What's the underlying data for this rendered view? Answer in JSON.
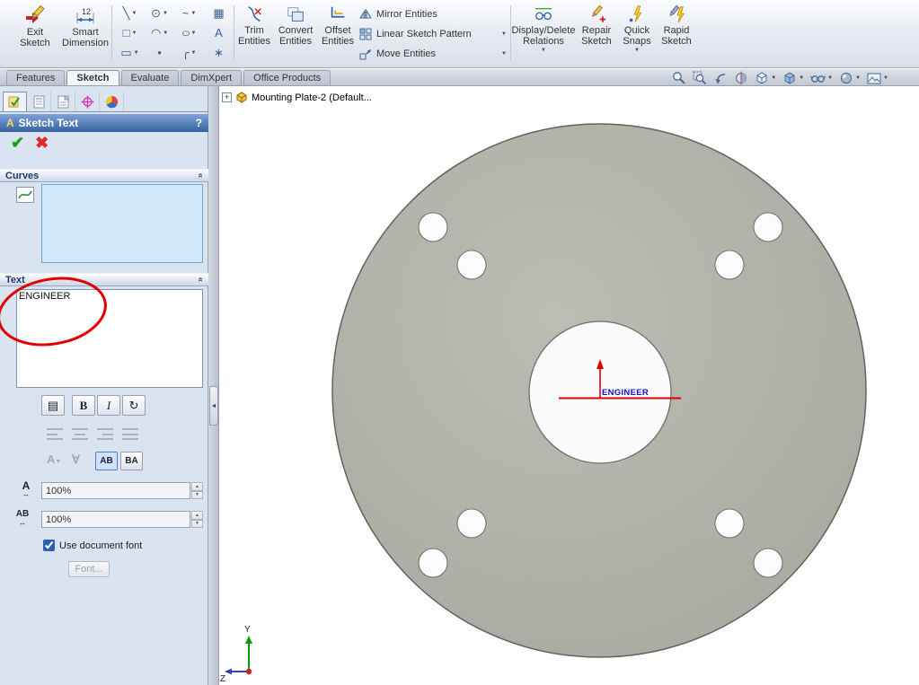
{
  "icons": {
    "dropdown": "▼",
    "collapse_chevron": "»",
    "ok": "✔",
    "cancel": "✖",
    "line": "╲",
    "circle": "⊙",
    "spline": "~",
    "grid": "▦",
    "rectangle": "□",
    "arc": "◠",
    "ellipse": "○",
    "text_tool": "A",
    "slot": "▭",
    "point": "•",
    "fillet": "╭",
    "pattern": "∗",
    "style": "▤",
    "bold": "B",
    "italic": "I",
    "rotate": "↻",
    "flip_vertical": "A",
    "flip_horizontal": "∀",
    "h_arrow": "↔",
    "expand_plus": "+",
    "splitter_arrow": "◄",
    "width_factor_glyph": "A",
    "spacing_glyph": "AB"
  },
  "ribbon": {
    "exit_sketch": "Exit\nSketch",
    "smart_dimension": "Smart\nDimension",
    "trim_entities": "Trim\nEntities",
    "convert_entities": "Convert\nEntities",
    "offset_entities": "Offset\nEntities",
    "mirror_entities": "Mirror Entities",
    "linear_sketch_pattern": "Linear Sketch Pattern",
    "move_entities": "Move Entities",
    "display_delete_relations": "Display/Delete\nRelations",
    "repair_sketch": "Repair\nSketch",
    "quick_snaps": "Quick\nSnaps",
    "rapid_sketch": "Rapid\nSketch"
  },
  "tabs": {
    "features": "Features",
    "sketch": "Sketch",
    "evaluate": "Evaluate",
    "dimxpert": "DimXpert",
    "office_products": "Office Products"
  },
  "property_manager": {
    "title": "Sketch Text",
    "help": "?",
    "curves_label": "Curves",
    "text_label": "Text",
    "text_value": "ENGINEER",
    "ab_label": "AB",
    "ba_label": "BA",
    "width_factor_value": "100%",
    "spacing_value": "100%",
    "use_document_font_label": "Use document font",
    "font_button_label": "Font..."
  },
  "viewport": {
    "model_name": "Mounting Plate-2  (Default...",
    "sketch_text": "ENGINEER",
    "triad_y": "Y",
    "triad_z": "Z"
  }
}
